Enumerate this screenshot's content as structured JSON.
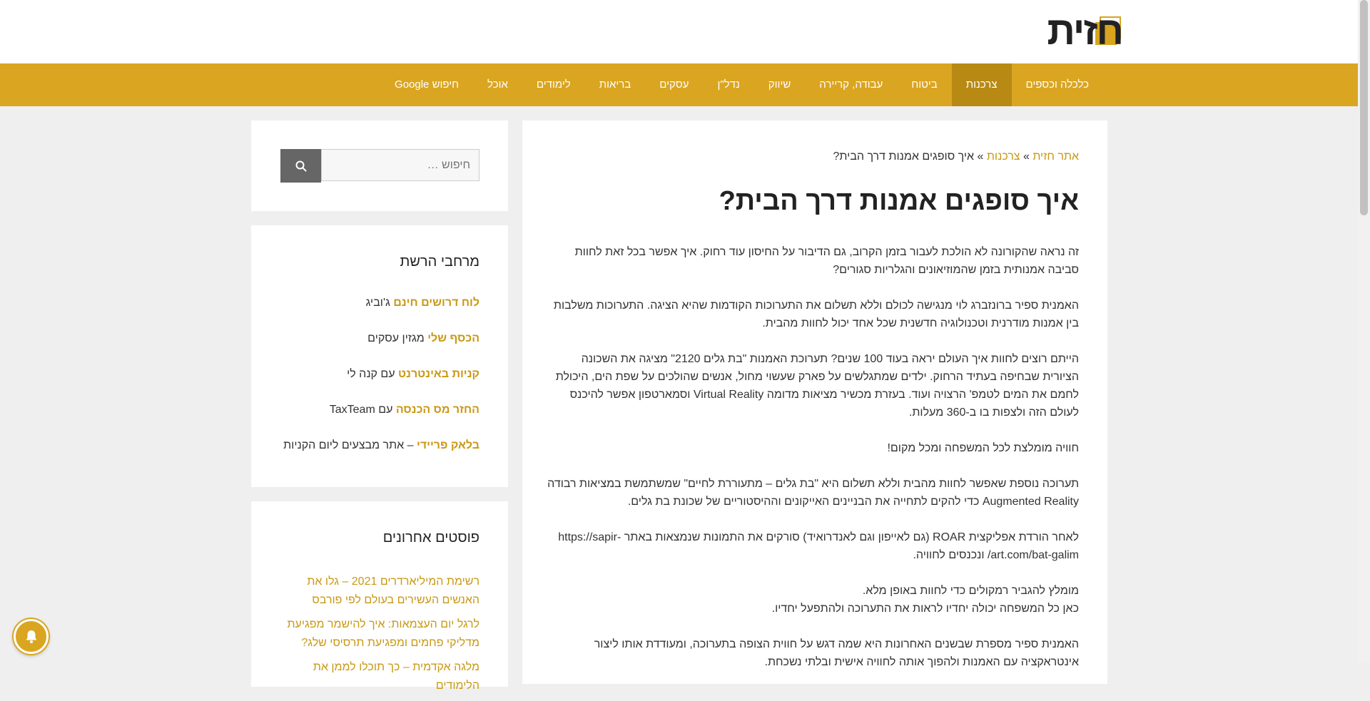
{
  "header": {
    "logo_text": "חזית"
  },
  "nav": {
    "items": [
      {
        "label": "כלכלה וכספים",
        "active": false
      },
      {
        "label": "צרכנות",
        "active": true
      },
      {
        "label": "ביטוח",
        "active": false
      },
      {
        "label": "עבודה, קריירה",
        "active": false
      },
      {
        "label": "שיווק",
        "active": false
      },
      {
        "label": "נדל\"ן",
        "active": false
      },
      {
        "label": "עסקים",
        "active": false
      },
      {
        "label": "בריאות",
        "active": false
      },
      {
        "label": "לימודים",
        "active": false
      },
      {
        "label": "אוכל",
        "active": false
      },
      {
        "label": "חיפוש Google",
        "active": false
      }
    ]
  },
  "breadcrumb": {
    "home": "אתר חזית",
    "sep": "»",
    "category": "צרכנות",
    "current": "איך סופגים אמנות דרך הבית?"
  },
  "post": {
    "title": "איך סופגים אמנות דרך הבית?",
    "paragraphs": [
      "זה נראה שהקורונה לא הולכת לעבור בזמן הקרוב, גם הדיבור על החיסון עוד רחוק. איך אפשר בכל זאת לחוות סביבה אמנותית בזמן שהמוזיאונים והגלריות סגורים?",
      "האמנית ספיר ברונזברג לוי מנגישה לכולם וללא תשלום את התערוכות הקודמות שהיא הציגה. התערוכות משלבות בין אמנות מודרנית וטכנולוגיה חדשנית שכל אחד יכול לחוות מהבית.",
      "הייתם רוצים לחוות איך העולם יראה בעוד 100 שנים? תערוכת האמנות \"בת גלים 2120\" מציגה את השכונה הציורית שבחיפה בעתיד הרחוק. ילדים שמתגלשים על פארק שעשוי מחול, אנשים שהולכים על שפת הים, היכולת לחמם את המים לטמפ' הרצויה ועוד. בעזרת מכשיר מציאות מדומה Virtual Reality וסמארטפון אפשר להיכנס לעולם הזה ולצפות בו ב-360 מעלות.",
      "חוויה מומלצת לכל המשפחה ומכל מקום!",
      "תערוכה נוספת שאפשר לחוות מהבית וללא תשלום היא \"בת גלים – מתעוררת לחיים\" שמשתמשת במציאות רבודה Augmented Reality כדי להקים לתחייה את הבניינים האייקונים וההיסטוריים של שכונת בת גלים.",
      "לאחר הורדת אפליקצית ROAR (גם לאייפון וגם לאנדרואיד) סורקים את התמונות שנמצאות באתר https://sapir-art.com/bat-galim/ ונכנסים לחוויה.",
      "מומלץ להגביר רמקולים כדי לחוות באופן מלא.",
      "כאן כל המשפחה יכולה יחדיו לראות את התערוכה ולהתפעל יחדיו.",
      "האמנית ספיר מספרת שבשנים האחרונות היא שמה דגש על חווית הצופה בתערוכה, ומעודדת אותו ליצור אינטראקציה עם האמנות ולהפוך אותה לחוויה אישית ובלתי נשכחת."
    ]
  },
  "sidebar": {
    "search": {
      "placeholder": "חיפוש …"
    },
    "network": {
      "title": "מרחבי הרשת",
      "items": [
        {
          "link": "לוח דרושים חינם",
          "rest": " ג'וביג"
        },
        {
          "link": "הכסף שלי",
          "rest": " מגזין עסקים"
        },
        {
          "link": "קניות באינטרנט",
          "rest": " עם קנה לי"
        },
        {
          "link": "החזר מס הכנסה",
          "rest": " עם TaxTeam"
        },
        {
          "link": "בלאק פריידי",
          "rest": " – אתר מבצעים ליום הקניות"
        }
      ]
    },
    "recent": {
      "title": "פוסטים אחרונים",
      "items": [
        "רשימת המיליארדרים 2021 – גלו את האנשים העשירים בעולם לפי פורבס",
        "לרגל יום העצמאות: איך להישמר מפגיעת מדליקי פחמים ומפגיעת תרסיסי שלג?",
        "מלגה אקדמית – כך תוכלו לממן את הלימודים"
      ]
    }
  },
  "colors": {
    "accent": "#daa520",
    "accent_dark": "#b88a14",
    "link": "#c99814"
  },
  "icons": {
    "search_button": "search-icon",
    "notification": "bell-icon"
  }
}
